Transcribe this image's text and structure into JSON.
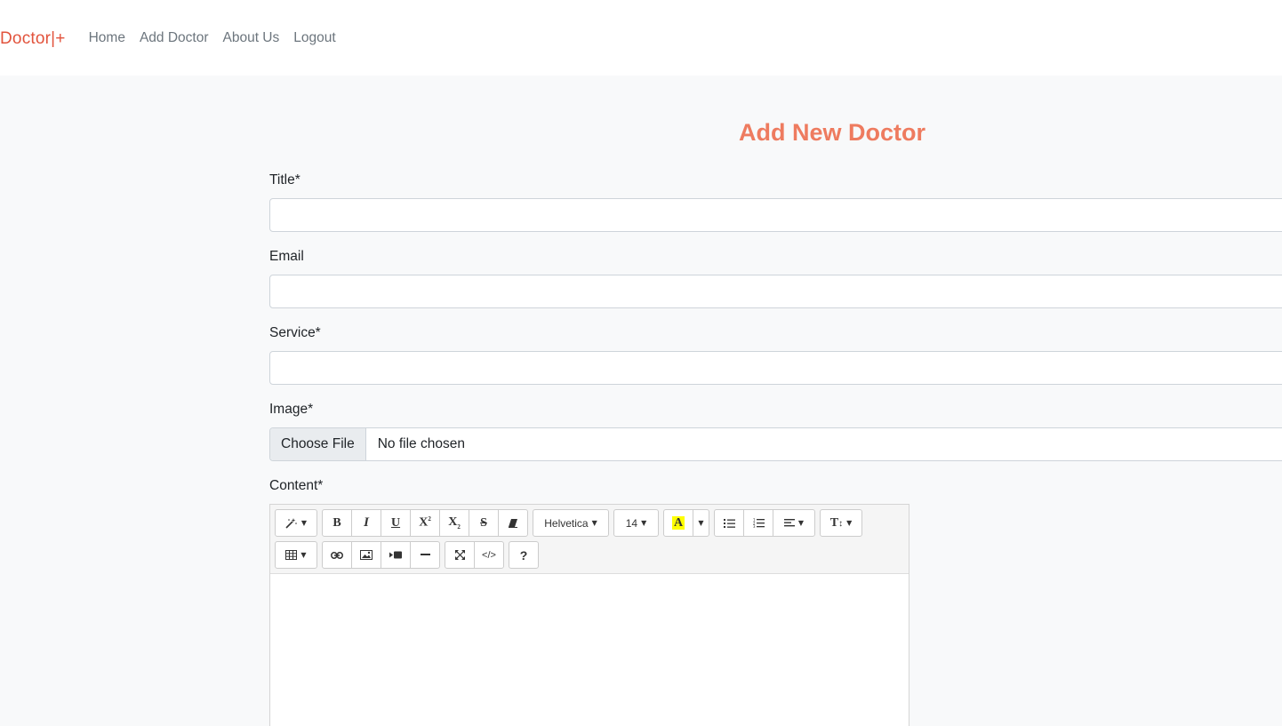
{
  "navbar": {
    "brand": "Doctor|+",
    "links": [
      "Home",
      "Add Doctor",
      "About Us",
      "Logout"
    ]
  },
  "page": {
    "title": "Add New Doctor"
  },
  "form": {
    "title_label": "Title*",
    "title_value": "",
    "email_label": "Email",
    "email_value": "",
    "service_label": "Service*",
    "service_value": "",
    "image_label": "Image*",
    "file_button": "Choose File",
    "file_status": "No file chosen",
    "content_label": "Content*"
  },
  "editor": {
    "font_name": "Helvetica",
    "font_size": "14",
    "highlight_letter": "A",
    "toolbar_icons": [
      "magic-icon",
      "bold-icon",
      "italic-icon",
      "underline-icon",
      "superscript-icon",
      "subscript-icon",
      "strikethrough-icon",
      "eraser-icon",
      "font-name-dropdown",
      "font-size-dropdown",
      "color-icon",
      "unordered-list-icon",
      "ordered-list-icon",
      "align-icon",
      "line-height-icon",
      "table-icon",
      "link-icon",
      "picture-icon",
      "video-icon",
      "horizontal-rule-icon",
      "fullscreen-icon",
      "code-view-icon",
      "help-icon"
    ],
    "content": ""
  },
  "colors": {
    "brand": "#e2533c",
    "title": "#ee7b5f",
    "nav_text": "#6c757d",
    "page_bg": "#f8f9fa"
  }
}
